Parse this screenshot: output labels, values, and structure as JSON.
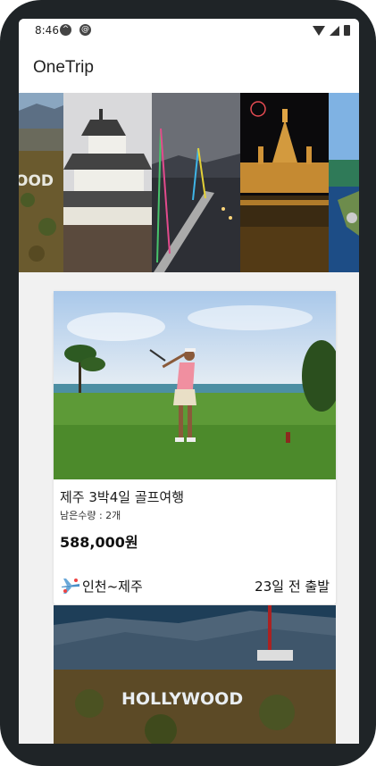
{
  "status_bar": {
    "time": "8:46"
  },
  "app": {
    "title": "OneTrip"
  },
  "banner": {
    "images": [
      {
        "name": "hollywood-sign"
      },
      {
        "name": "japanese-castle"
      },
      {
        "name": "bridge-night"
      },
      {
        "name": "parliament-night"
      },
      {
        "name": "coastline"
      }
    ]
  },
  "products": [
    {
      "title": "제주 3박4일 골프여행",
      "remaining": "남은수량 : 2개",
      "price": "588,000원",
      "route": "인천~제주",
      "departure": "23일 전 출발",
      "image": "golf-course"
    },
    {
      "image": "hollywood-hills",
      "sign_text": "HOLLYWOOD"
    }
  ],
  "colors": {
    "background": "#f1f1f1",
    "card": "#ffffff",
    "text": "#111111"
  }
}
